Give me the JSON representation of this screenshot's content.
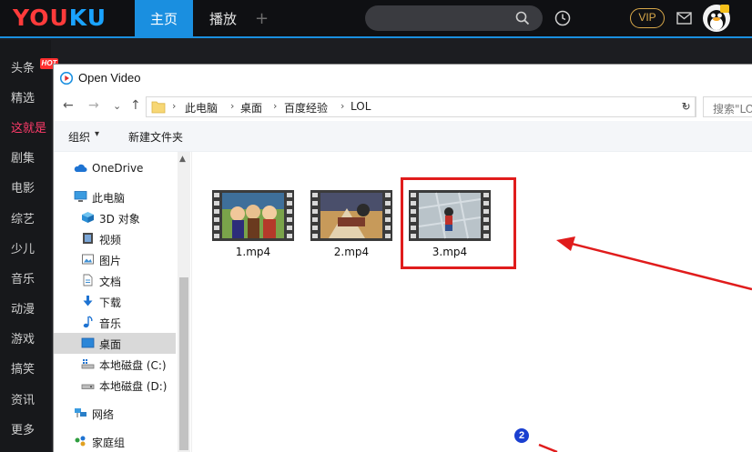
{
  "app": {
    "logo_left": "YOU",
    "logo_right": "KU",
    "tabs": [
      {
        "label": "主页",
        "active": true
      },
      {
        "label": "播放",
        "active": false
      }
    ],
    "plus": "+",
    "vip": "VIP"
  },
  "sidenav": {
    "hot_badge": "HOT",
    "items": [
      {
        "label": "头条"
      },
      {
        "label": "精选"
      },
      {
        "label": "这就是"
      },
      {
        "label": "剧集"
      },
      {
        "label": "电影"
      },
      {
        "label": "综艺"
      },
      {
        "label": "少儿"
      },
      {
        "label": "音乐"
      },
      {
        "label": "动漫"
      },
      {
        "label": "游戏"
      },
      {
        "label": "搞笑"
      },
      {
        "label": "资讯"
      },
      {
        "label": "更多"
      }
    ]
  },
  "dialog": {
    "title": "Open Video",
    "nav": {
      "back": "←",
      "forward": "→",
      "recent": "⌄",
      "up": "↑"
    },
    "breadcrumb": [
      "此电脑",
      "桌面",
      "百度经验",
      "LOL"
    ],
    "search_placeholder": "搜索\"LOL\"",
    "commands": {
      "organize": "组织",
      "new_folder": "新建文件夹"
    },
    "tree": [
      {
        "label": "OneDrive",
        "icon": "cloud-icon"
      },
      {
        "label": "此电脑",
        "icon": "computer-icon"
      },
      {
        "label": "3D 对象",
        "icon": "cube-icon"
      },
      {
        "label": "视频",
        "icon": "video-icon"
      },
      {
        "label": "图片",
        "icon": "picture-icon"
      },
      {
        "label": "文档",
        "icon": "document-icon"
      },
      {
        "label": "下载",
        "icon": "download-icon"
      },
      {
        "label": "音乐",
        "icon": "music-icon"
      },
      {
        "label": "桌面",
        "icon": "desktop-icon",
        "selected": true
      },
      {
        "label": "本地磁盘 (C:)",
        "icon": "drive-c-icon"
      },
      {
        "label": "本地磁盘 (D:)",
        "icon": "drive-d-icon"
      },
      {
        "label": "网络",
        "icon": "network-icon"
      },
      {
        "label": "家庭组",
        "icon": "homegroup-icon"
      }
    ],
    "files": [
      {
        "name": "1.mp4"
      },
      {
        "name": "2.mp4"
      },
      {
        "name": "3.mp4"
      }
    ]
  },
  "annotation": {
    "step": "2"
  },
  "colors": {
    "accent_blue": "#1a8fe0",
    "logo_red": "#ff3b3b",
    "logo_blue": "#1aa3ff",
    "highlight_red": "#e01c1c",
    "vip_gold": "#d9a94a"
  }
}
